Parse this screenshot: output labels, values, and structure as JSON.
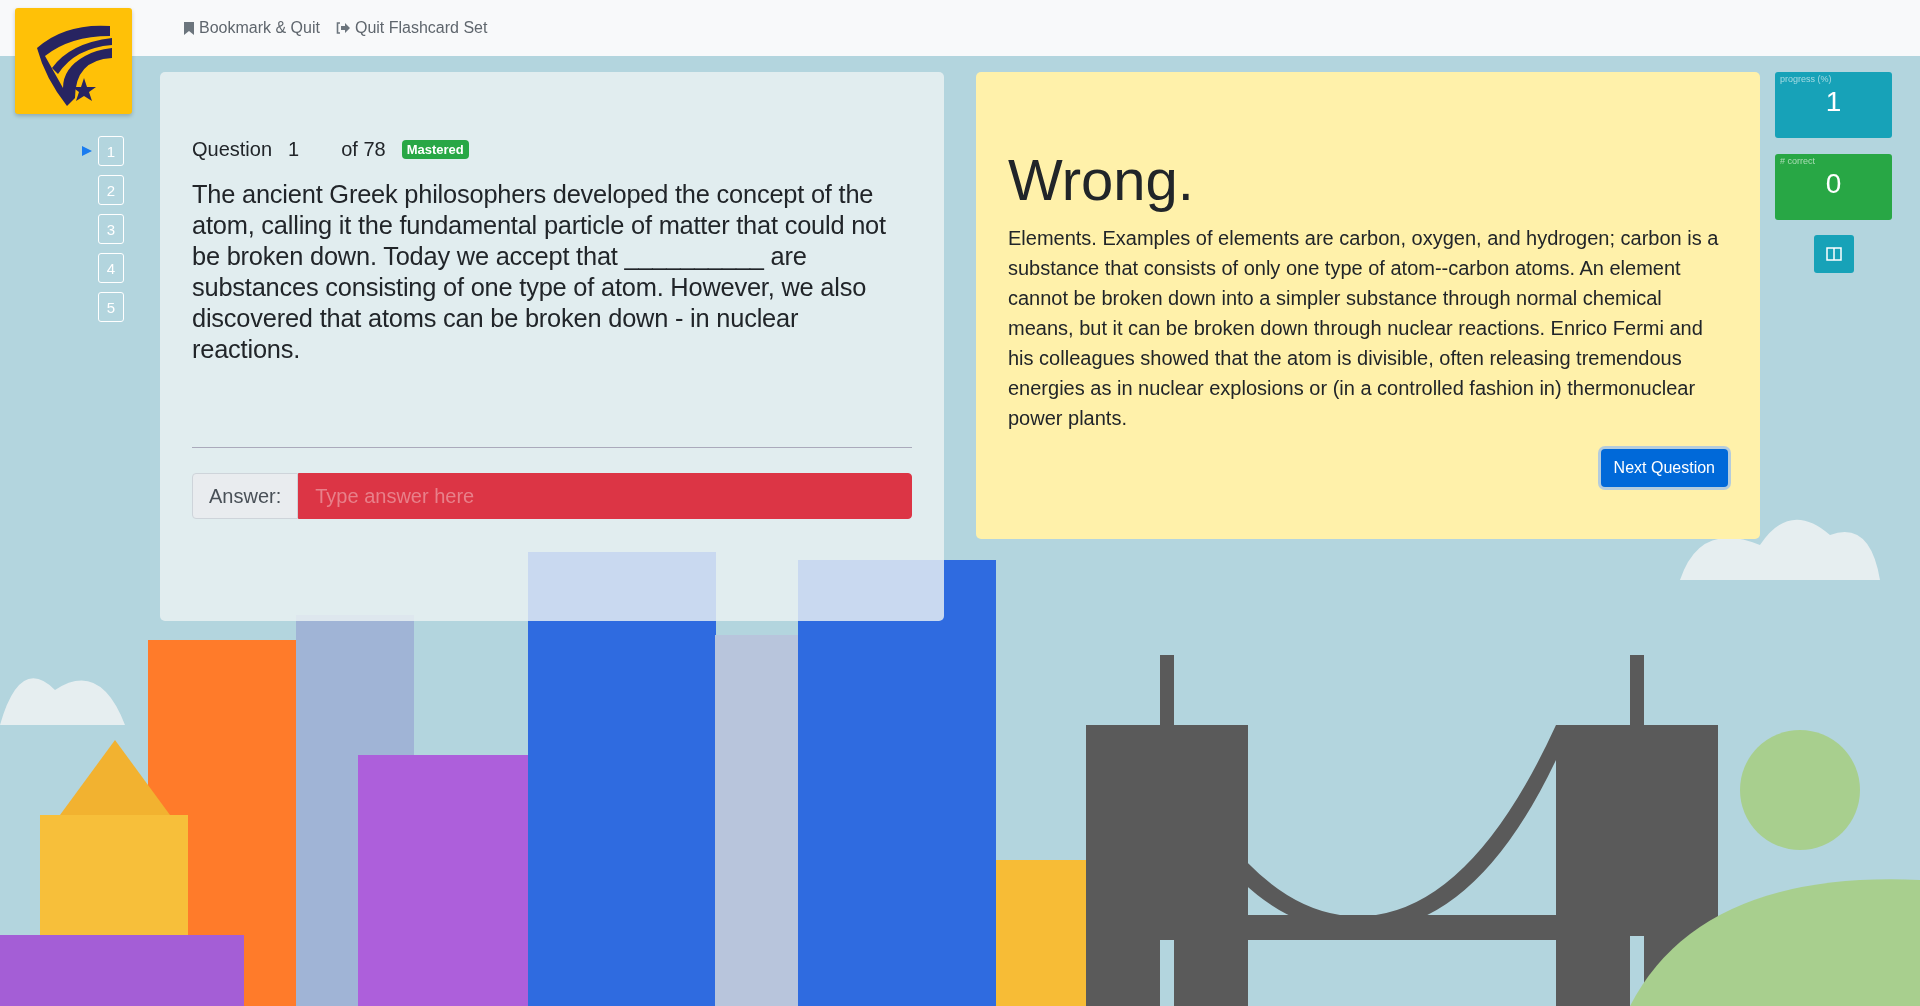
{
  "nav": [
    {
      "kind": "bookmark",
      "label": "Bookmark & Quit"
    },
    {
      "kind": "quit",
      "label": "Quit Flashcard Set"
    }
  ],
  "question_nav": [
    {
      "label": "1",
      "selected": true
    },
    {
      "label": "2",
      "selected": false
    },
    {
      "label": "3",
      "selected": false
    },
    {
      "label": "4",
      "selected": false
    },
    {
      "label": "5",
      "selected": false
    }
  ],
  "question": {
    "label": "Question",
    "number": "1",
    "total": "of 78",
    "badge": "Mastered",
    "text": "The ancient Greek philosophers developed the concept of the atom, calling it the fundamental particle of matter that could not be broken down. Today we accept that __________ are substances consisting of one type of atom. However, we also discovered that atoms can be broken down - in nuclear reactions."
  },
  "answer": {
    "label": "Answer:",
    "placeholder": "Type answer here",
    "correct": false
  },
  "result": {
    "heading": "Wrong.",
    "explanation": "Elements. Examples of elements are carbon, oxygen, and hydrogen; carbon is a substance that consists of only one type of atom--carbon atoms. An element cannot be broken down into a simpler substance through normal chemical means, but it can be broken down through nuclear reactions. Enrico Fermi and his colleagues showed that the atom is divisible, often releasing tremendous energies as in nuclear explosions or (in a controlled fashion in) thermonuclear power plants.",
    "button": "Next Question"
  },
  "stats": [
    {
      "label": "progress (%)",
      "value": "1",
      "color": "#17a2b8"
    },
    {
      "label": "# correct",
      "value": "0",
      "color": "#28a745"
    }
  ]
}
